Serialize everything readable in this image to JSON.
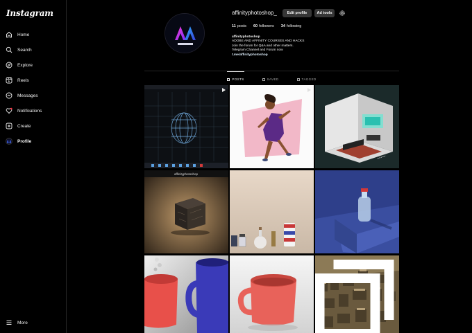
{
  "app": {
    "logo": "Instagram"
  },
  "nav": {
    "items": [
      {
        "label": "Home",
        "icon": "home-icon"
      },
      {
        "label": "Search",
        "icon": "search-icon"
      },
      {
        "label": "Explore",
        "icon": "compass-icon"
      },
      {
        "label": "Reels",
        "icon": "reels-icon"
      },
      {
        "label": "Messages",
        "icon": "messages-icon"
      },
      {
        "label": "Notifications",
        "icon": "heart-icon"
      },
      {
        "label": "Create",
        "icon": "plus-square-icon"
      },
      {
        "label": "Profile",
        "icon": "avatar"
      }
    ],
    "more": "More"
  },
  "profile": {
    "username": "affinityphotoshop_",
    "edit_button": "Edit profile",
    "ad_tools_button": "Ad tools",
    "stats": {
      "posts_count": "11",
      "posts_label": "posts",
      "followers_count": "60",
      "followers_label": "followers",
      "following_count": "34",
      "following_label": "following"
    },
    "bio": {
      "name": "affinityphotoshop",
      "line1": "ADOBE AND AFFINITY COURSES AND HACKS",
      "line2": "Join the forum for Q&A and other matters.",
      "line3": "Telegram Channel and Forum now",
      "link": "t.me/affinityphotoshop"
    }
  },
  "tabs": [
    {
      "label": "POSTS",
      "active": true
    },
    {
      "label": "SAVED",
      "active": false
    },
    {
      "label": "TAGGED",
      "active": false
    }
  ],
  "posts": [
    {
      "caption": "",
      "multi": false
    },
    {
      "caption": "",
      "multi": false
    },
    {
      "caption": "",
      "multi": false
    },
    {
      "caption": "affinityphotoshop",
      "multi": false
    },
    {
      "caption": "",
      "multi": false
    },
    {
      "caption": "",
      "multi": false
    },
    {
      "caption": "",
      "multi": false
    },
    {
      "caption": "",
      "multi": false
    },
    {
      "caption": "",
      "multi": true
    }
  ],
  "colors": {
    "background": "#000000",
    "button": "#363636",
    "border": "#262626",
    "text": "#f5f5f5",
    "muted": "#a8a8a8"
  }
}
